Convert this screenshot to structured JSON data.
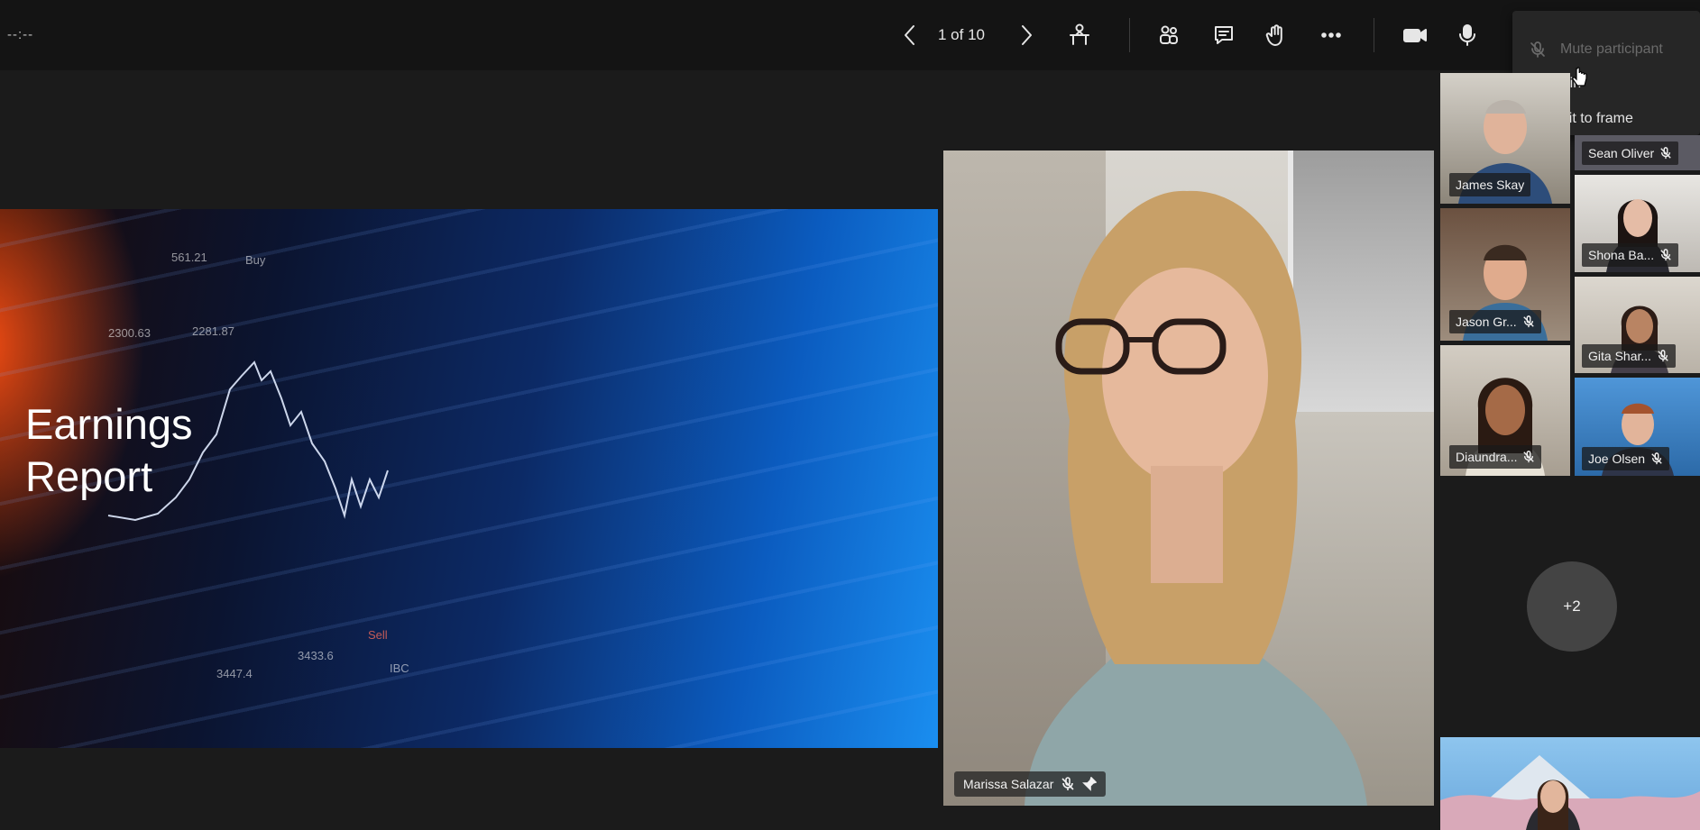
{
  "toolbar": {
    "timer": "--:--",
    "slide_counter": "1 of 10",
    "icons": [
      "chevron-left-icon",
      "chevron-right-icon",
      "presenter-view-icon",
      "participants-icon",
      "chat-icon",
      "raise-hand-icon",
      "more-options-icon",
      "camera-icon",
      "microphone-icon"
    ]
  },
  "context_menu": {
    "items": [
      {
        "label": "Mute participant",
        "icon": "mic-off-icon",
        "disabled": true
      },
      {
        "label": "Pin",
        "icon": "pin-icon",
        "disabled": false
      },
      {
        "label": "Fit to frame",
        "icon": "fit-frame-icon",
        "disabled": false
      }
    ]
  },
  "slide": {
    "title_line1": "Earnings",
    "title_line2": "Report",
    "tickers": [
      {
        "text": "561.21"
      },
      {
        "text": "3433.6"
      },
      {
        "text": "3447.4"
      },
      {
        "text": "2281.87"
      },
      {
        "text": "2300.63"
      },
      {
        "text": "IBC"
      },
      {
        "text": "Sell"
      },
      {
        "text": "Buy"
      }
    ]
  },
  "main_speaker": {
    "name": "Marissa Salazar",
    "status_icons": [
      "mic-off-icon",
      "pin-icon"
    ]
  },
  "participants": [
    {
      "name": "James Skay"
    },
    {
      "name": "Sean Oliver"
    },
    {
      "name": "Shona Ba..."
    },
    {
      "name": "Jason Gr..."
    },
    {
      "name": "Gita Shar..."
    },
    {
      "name": "Diaundra..."
    },
    {
      "name": "Joe Olsen"
    }
  ],
  "overflow_count": "+2",
  "colors": {
    "background": "#1b1b1b",
    "toolbar": "#141414",
    "menu": "#262626"
  }
}
